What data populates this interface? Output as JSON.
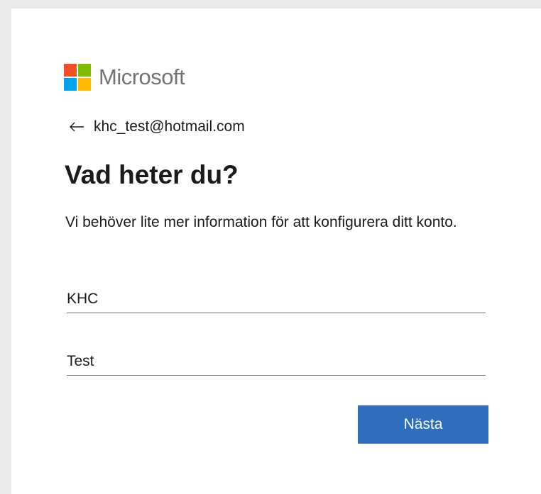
{
  "brand": {
    "name": "Microsoft",
    "colors": [
      "#f25022",
      "#7fba00",
      "#00a4ef",
      "#ffb900"
    ]
  },
  "account": {
    "email": "khc_test@hotmail.com",
    "back_icon": "arrow-left-icon"
  },
  "page": {
    "title": "Vad heter du?",
    "description": "Vi behöver lite mer information för att konfigurera ditt konto."
  },
  "form": {
    "first_name_value": "KHC",
    "last_name_value": "Test",
    "next_label": "Nästa",
    "button_color": "#2e6ebc"
  }
}
